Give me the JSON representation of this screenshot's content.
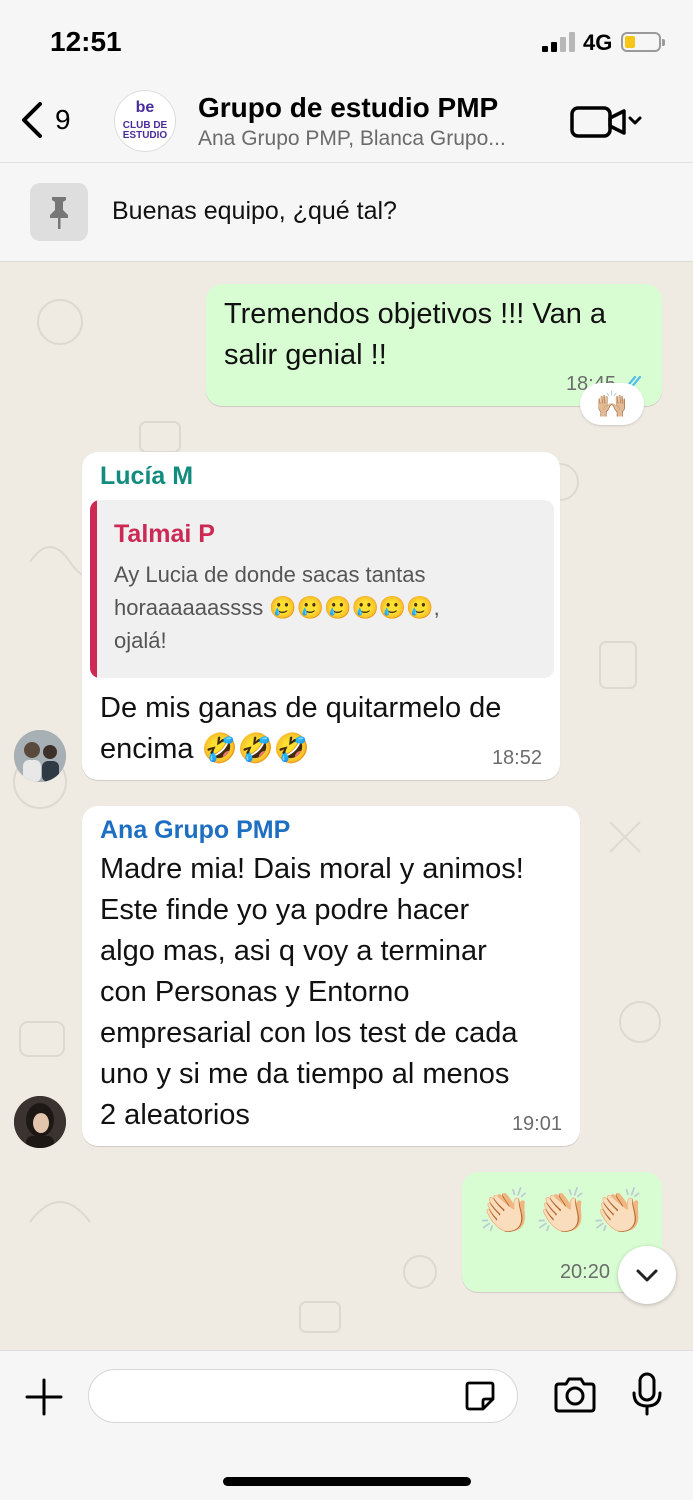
{
  "status": {
    "time": "12:51",
    "network": "4G"
  },
  "header": {
    "back_count": "9",
    "avatar_text_top": "be",
    "avatar_text_line1": "CLUB DE",
    "avatar_text_line2": "ESTUDIO",
    "title": "Grupo de estudio PMP",
    "subtitle": "Ana Grupo PMP, Blanca Grupo..."
  },
  "pinned": {
    "text": "Buenas equipo, ¿qué tal?"
  },
  "messages": [
    {
      "text_line1": "Tremendos objetivos !!! Van a",
      "text_line2": "salir genial !!",
      "time": "18:45",
      "reaction": "🙌🏼"
    },
    {
      "sender": "Lucía M",
      "quote_sender": "Talmai P",
      "quote_line1": "Ay Lucia de donde sacas tantas",
      "quote_line2": "horaaaaaassss 🥲🥲🥲🥲🥲🥲,",
      "quote_line3": "ojalá!",
      "text_line1": "De mis ganas de quitarmelo de",
      "text_line2": "encima 🤣🤣🤣",
      "time": "18:52"
    },
    {
      "sender": "Ana Grupo PMP",
      "lines": [
        "Madre mia! Dais moral y animos!",
        "Este finde yo ya podre hacer",
        "algo mas, asi q voy a terminar",
        "con Personas y Entorno",
        "empresarial con los test de cada",
        "uno y si me da tiempo al menos",
        "2 aleatorios"
      ],
      "time": "19:01"
    },
    {
      "text": "👏🏻👏🏻👏🏻",
      "time": "20:20"
    }
  ],
  "colors": {
    "out_bubble": "#d9fdd3",
    "in_bubble": "#ffffff",
    "sender_lucia": "#128c7e",
    "sender_ana": "#1e6fc2",
    "quote_sender": "#cc2a55",
    "read_ticks": "#53bdeb"
  }
}
